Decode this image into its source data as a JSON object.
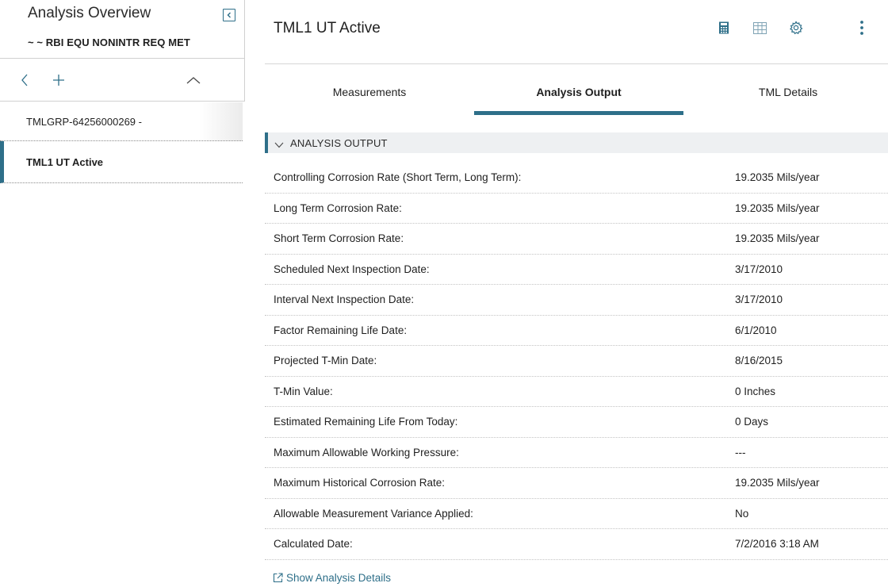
{
  "left_panel": {
    "title": "Analysis Overview",
    "subtitle": "~ ~ RBI EQU NONINTR REQ MET",
    "collapse_icon": "collapse-left-icon",
    "toolbar": {
      "back_icon": "chevron-left-icon",
      "add_icon": "plus-icon",
      "collapse_up_icon": "chevron-up-icon"
    },
    "tree_items": [
      {
        "label": "TMLGRP-64256000269 -",
        "active": false
      },
      {
        "label": "TML1 UT Active",
        "active": true
      }
    ]
  },
  "header": {
    "title": "TML1 UT Active",
    "icons": [
      "calculator-icon",
      "grid-table-icon",
      "gear-icon",
      "more-vertical-icon"
    ]
  },
  "tabs": [
    {
      "label": "Measurements",
      "active": false
    },
    {
      "label": "Analysis Output",
      "active": true
    },
    {
      "label": "TML Details",
      "active": false
    }
  ],
  "section": {
    "label": "ANALYSIS OUTPUT",
    "expanded": true
  },
  "rows": [
    {
      "label": "Controlling Corrosion Rate (Short Term, Long Term):",
      "value": "19.2035 Mils/year"
    },
    {
      "label": "Long Term Corrosion Rate:",
      "value": "19.2035 Mils/year"
    },
    {
      "label": "Short Term Corrosion Rate:",
      "value": "19.2035 Mils/year"
    },
    {
      "label": "Scheduled Next Inspection Date:",
      "value": "3/17/2010"
    },
    {
      "label": "Interval Next Inspection Date:",
      "value": "3/17/2010"
    },
    {
      "label": "Factor Remaining Life Date:",
      "value": "6/1/2010"
    },
    {
      "label": "Projected T-Min Date:",
      "value": "8/16/2015"
    },
    {
      "label": "T-Min Value:",
      "value": "0 Inches"
    },
    {
      "label": "Estimated Remaining Life From Today:",
      "value": "0 Days"
    },
    {
      "label": "Maximum Allowable Working Pressure:",
      "value": "---"
    },
    {
      "label": "Maximum Historical Corrosion Rate:",
      "value": "19.2035 Mils/year"
    },
    {
      "label": "Allowable Measurement Variance Applied:",
      "value": "No"
    },
    {
      "label": "Calculated Date:",
      "value": "7/2/2016 3:18 AM"
    }
  ],
  "details_link": {
    "label": "Show Analysis Details",
    "icon": "external-link-icon"
  },
  "colors": {
    "accent": "#2e6f89",
    "section_bg": "#eef0f2",
    "divider": "#d0d0d0"
  }
}
